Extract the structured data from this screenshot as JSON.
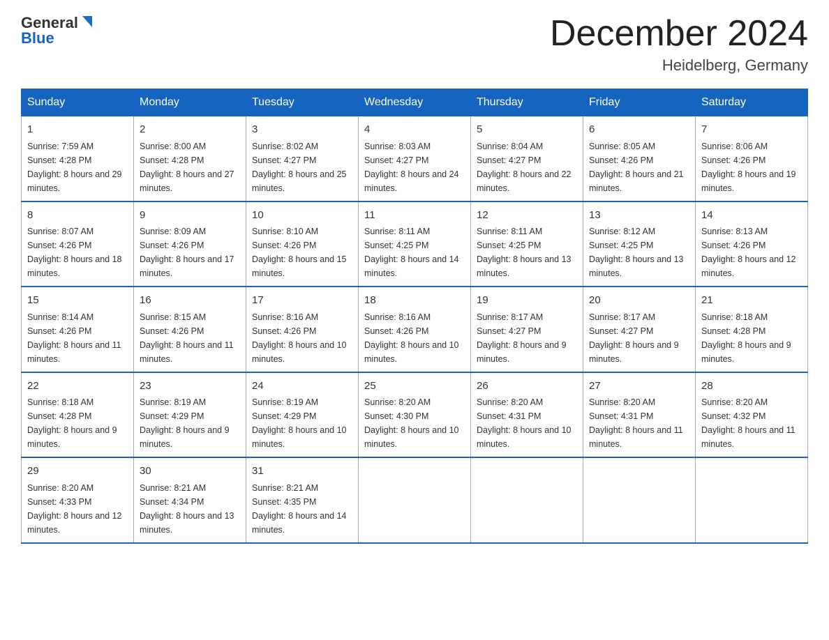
{
  "header": {
    "logo_general": "General",
    "logo_blue": "Blue",
    "month_title": "December 2024",
    "location": "Heidelberg, Germany"
  },
  "days_of_week": [
    "Sunday",
    "Monday",
    "Tuesday",
    "Wednesday",
    "Thursday",
    "Friday",
    "Saturday"
  ],
  "weeks": [
    [
      {
        "day": "1",
        "sunrise": "7:59 AM",
        "sunset": "4:28 PM",
        "daylight": "8 hours and 29 minutes."
      },
      {
        "day": "2",
        "sunrise": "8:00 AM",
        "sunset": "4:28 PM",
        "daylight": "8 hours and 27 minutes."
      },
      {
        "day": "3",
        "sunrise": "8:02 AM",
        "sunset": "4:27 PM",
        "daylight": "8 hours and 25 minutes."
      },
      {
        "day": "4",
        "sunrise": "8:03 AM",
        "sunset": "4:27 PM",
        "daylight": "8 hours and 24 minutes."
      },
      {
        "day": "5",
        "sunrise": "8:04 AM",
        "sunset": "4:27 PM",
        "daylight": "8 hours and 22 minutes."
      },
      {
        "day": "6",
        "sunrise": "8:05 AM",
        "sunset": "4:26 PM",
        "daylight": "8 hours and 21 minutes."
      },
      {
        "day": "7",
        "sunrise": "8:06 AM",
        "sunset": "4:26 PM",
        "daylight": "8 hours and 19 minutes."
      }
    ],
    [
      {
        "day": "8",
        "sunrise": "8:07 AM",
        "sunset": "4:26 PM",
        "daylight": "8 hours and 18 minutes."
      },
      {
        "day": "9",
        "sunrise": "8:09 AM",
        "sunset": "4:26 PM",
        "daylight": "8 hours and 17 minutes."
      },
      {
        "day": "10",
        "sunrise": "8:10 AM",
        "sunset": "4:26 PM",
        "daylight": "8 hours and 15 minutes."
      },
      {
        "day": "11",
        "sunrise": "8:11 AM",
        "sunset": "4:25 PM",
        "daylight": "8 hours and 14 minutes."
      },
      {
        "day": "12",
        "sunrise": "8:11 AM",
        "sunset": "4:25 PM",
        "daylight": "8 hours and 13 minutes."
      },
      {
        "day": "13",
        "sunrise": "8:12 AM",
        "sunset": "4:25 PM",
        "daylight": "8 hours and 13 minutes."
      },
      {
        "day": "14",
        "sunrise": "8:13 AM",
        "sunset": "4:26 PM",
        "daylight": "8 hours and 12 minutes."
      }
    ],
    [
      {
        "day": "15",
        "sunrise": "8:14 AM",
        "sunset": "4:26 PM",
        "daylight": "8 hours and 11 minutes."
      },
      {
        "day": "16",
        "sunrise": "8:15 AM",
        "sunset": "4:26 PM",
        "daylight": "8 hours and 11 minutes."
      },
      {
        "day": "17",
        "sunrise": "8:16 AM",
        "sunset": "4:26 PM",
        "daylight": "8 hours and 10 minutes."
      },
      {
        "day": "18",
        "sunrise": "8:16 AM",
        "sunset": "4:26 PM",
        "daylight": "8 hours and 10 minutes."
      },
      {
        "day": "19",
        "sunrise": "8:17 AM",
        "sunset": "4:27 PM",
        "daylight": "8 hours and 9 minutes."
      },
      {
        "day": "20",
        "sunrise": "8:17 AM",
        "sunset": "4:27 PM",
        "daylight": "8 hours and 9 minutes."
      },
      {
        "day": "21",
        "sunrise": "8:18 AM",
        "sunset": "4:28 PM",
        "daylight": "8 hours and 9 minutes."
      }
    ],
    [
      {
        "day": "22",
        "sunrise": "8:18 AM",
        "sunset": "4:28 PM",
        "daylight": "8 hours and 9 minutes."
      },
      {
        "day": "23",
        "sunrise": "8:19 AM",
        "sunset": "4:29 PM",
        "daylight": "8 hours and 9 minutes."
      },
      {
        "day": "24",
        "sunrise": "8:19 AM",
        "sunset": "4:29 PM",
        "daylight": "8 hours and 10 minutes."
      },
      {
        "day": "25",
        "sunrise": "8:20 AM",
        "sunset": "4:30 PM",
        "daylight": "8 hours and 10 minutes."
      },
      {
        "day": "26",
        "sunrise": "8:20 AM",
        "sunset": "4:31 PM",
        "daylight": "8 hours and 10 minutes."
      },
      {
        "day": "27",
        "sunrise": "8:20 AM",
        "sunset": "4:31 PM",
        "daylight": "8 hours and 11 minutes."
      },
      {
        "day": "28",
        "sunrise": "8:20 AM",
        "sunset": "4:32 PM",
        "daylight": "8 hours and 11 minutes."
      }
    ],
    [
      {
        "day": "29",
        "sunrise": "8:20 AM",
        "sunset": "4:33 PM",
        "daylight": "8 hours and 12 minutes."
      },
      {
        "day": "30",
        "sunrise": "8:21 AM",
        "sunset": "4:34 PM",
        "daylight": "8 hours and 13 minutes."
      },
      {
        "day": "31",
        "sunrise": "8:21 AM",
        "sunset": "4:35 PM",
        "daylight": "8 hours and 14 minutes."
      },
      null,
      null,
      null,
      null
    ]
  ],
  "labels": {
    "sunrise_prefix": "Sunrise: ",
    "sunset_prefix": "Sunset: ",
    "daylight_prefix": "Daylight: "
  }
}
